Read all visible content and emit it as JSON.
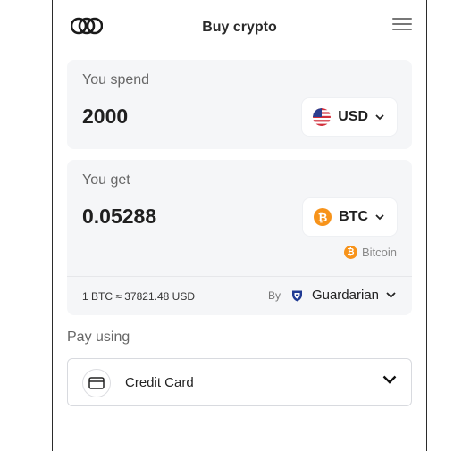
{
  "header": {
    "title": "Buy crypto",
    "logo_icon": "triple-ring-logo-icon",
    "menu_icon": "hamburger-menu-icon"
  },
  "spend": {
    "label": "You spend",
    "amount": "2000",
    "currency_code": "USD",
    "currency_icon": "us-flag-icon"
  },
  "get": {
    "label": "You get",
    "amount": "0.05288",
    "currency_code": "BTC",
    "currency_icon": "bitcoin-icon",
    "coin_name": "Bitcoin",
    "rate": "1 BTC ≈ 37821.48 USD",
    "provider_by": "By",
    "provider_name": "Guardarian"
  },
  "payment": {
    "label": "Pay using",
    "method": "Credit Card",
    "method_icon": "credit-card-icon"
  },
  "colors": {
    "bitcoin": "#f7931a",
    "card_bg": "#f5f6f8",
    "provider_logo": "#1f3a93"
  }
}
